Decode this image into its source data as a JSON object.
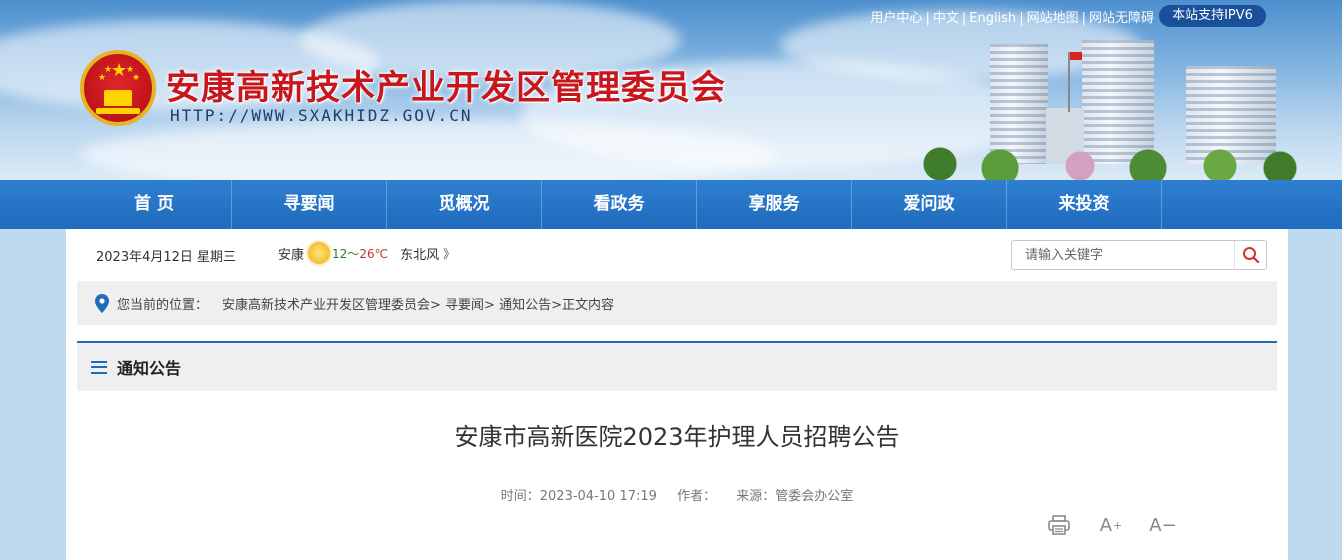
{
  "header": {
    "site_title": "安康高新技术产业开发区管理委员会",
    "site_url": "HTTP://WWW.SXAKHIDZ.GOV.CN",
    "top_links": [
      "用户中心",
      "中文",
      "English",
      "网站地图",
      "网站无障碍"
    ],
    "ipv6_badge": "本站支持IPV6"
  },
  "nav": {
    "items": [
      "首 页",
      "寻要闻",
      "觅概况",
      "看政务",
      "享服务",
      "爱问政",
      "来投资"
    ]
  },
  "infobar": {
    "date": "2023年4月12日 星期三",
    "city": "安康",
    "temp_low": "12",
    "temp_sep": "～",
    "temp_high": "26℃",
    "wind": "东北风",
    "more": "》"
  },
  "search": {
    "placeholder": "请输入关键字"
  },
  "breadcrumb": {
    "label": "您当前的位置：",
    "path": "安康高新技术产业开发区管理委员会> 寻要闻> 通知公告>正文内容"
  },
  "section": {
    "title": "通知公告"
  },
  "article": {
    "title": "安康市高新医院2023年护理人员招聘公告",
    "time_label": "时间：2023-04-10 17:19",
    "author_label": "作者：",
    "source_label": "来源：管委会办公室"
  },
  "tools": {
    "enlarge_label": "A",
    "enlarge_sup": "+",
    "shrink_label": "A−"
  },
  "colors": {
    "nav_blue": "#1f6bbd",
    "title_red": "#c8161d",
    "ipv6_bg": "#1a4f9a"
  }
}
